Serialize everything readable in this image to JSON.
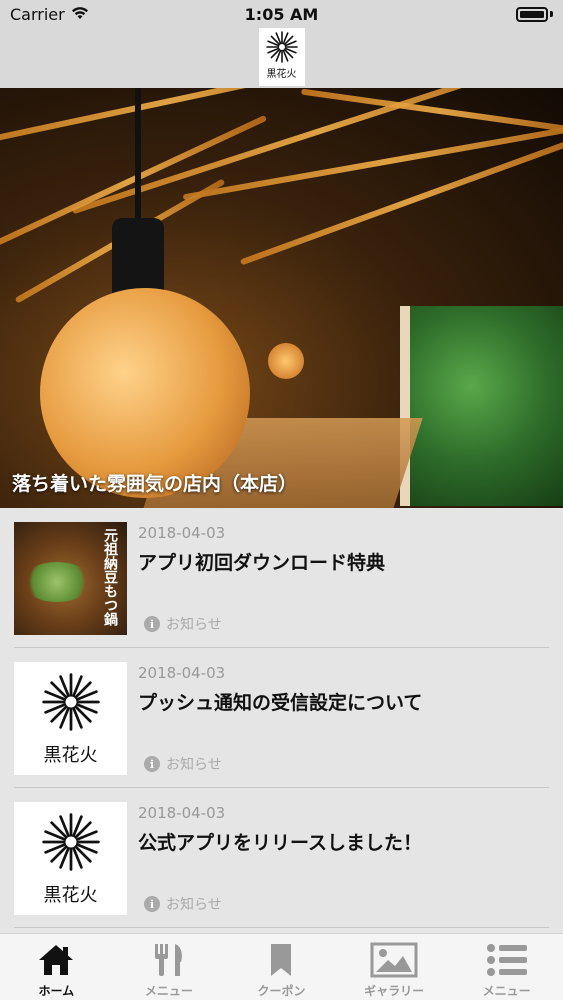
{
  "status_bar": {
    "carrier": "Carrier",
    "time": "1:05 AM"
  },
  "header": {
    "logo_text": "黒花火"
  },
  "hero": {
    "caption": "落ち着いた雰囲気の店内（本店）"
  },
  "news": [
    {
      "date": "2018-04-03",
      "title": "アプリ初回ダウンロード特典",
      "category": "お知らせ",
      "thumb": "photo",
      "thumb_text": "元祖納豆もつ鍋"
    },
    {
      "date": "2018-04-03",
      "title": "プッシュ通知の受信設定について",
      "category": "お知らせ",
      "thumb": "logo",
      "thumb_text": "黒花火"
    },
    {
      "date": "2018-04-03",
      "title": "公式アプリをリリースしました！",
      "category": "お知らせ",
      "thumb": "logo",
      "thumb_text": "黒花火"
    }
  ],
  "tabs": [
    {
      "label": "ホーム",
      "icon": "home-icon",
      "active": true
    },
    {
      "label": "メニュー",
      "icon": "cutlery-icon",
      "active": false
    },
    {
      "label": "クーポン",
      "icon": "bookmark-icon",
      "active": false
    },
    {
      "label": "ギャラリー",
      "icon": "image-icon",
      "active": false
    },
    {
      "label": "メニュー",
      "icon": "list-icon",
      "active": false
    }
  ],
  "colors": {
    "accent": "#111111",
    "inactive": "#999999",
    "header_bg": "#d9d9d9",
    "list_bg": "#e5e5e5"
  }
}
